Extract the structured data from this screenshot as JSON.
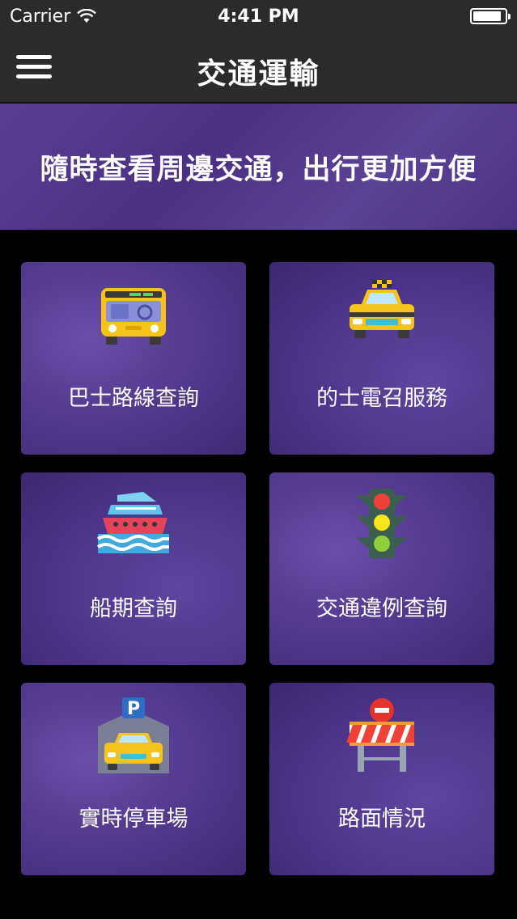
{
  "status": {
    "carrier": "Carrier",
    "time": "4:41 PM",
    "battery_level": 0.9
  },
  "navbar": {
    "title": "交通運輸"
  },
  "banner": {
    "text": "隨時查看周邊交通，出行更加方便"
  },
  "tiles": [
    {
      "label": "巴士路線查詢",
      "icon": "bus-icon"
    },
    {
      "label": "的士電召服務",
      "icon": "taxi-icon"
    },
    {
      "label": "船期查詢",
      "icon": "ferry-icon"
    },
    {
      "label": "交通違例查詢",
      "icon": "traffic-light-icon"
    },
    {
      "label": "實時停車場",
      "icon": "parking-icon"
    },
    {
      "label": "路面情況",
      "icon": "roadblock-icon"
    }
  ],
  "colors": {
    "bar": "#2b2b2b",
    "tile": "#4f378c",
    "accent_yellow": "#f6c31b"
  }
}
